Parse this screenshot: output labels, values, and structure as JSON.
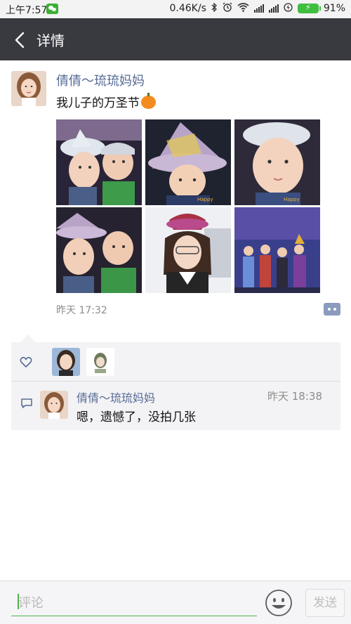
{
  "status_bar": {
    "time": "上午7:57",
    "speed": "0.46K/s",
    "battery": "91%"
  },
  "nav": {
    "title": "详情"
  },
  "post": {
    "author": "倩倩～琉琉妈妈",
    "text": "我儿子的万圣节",
    "time": "昨天 17:32",
    "photo_count": 6
  },
  "comments": [
    {
      "author": "倩倩～琉琉妈妈",
      "time": "昨天 18:38",
      "text": "嗯，遗憾了，没拍几张"
    }
  ],
  "input": {
    "placeholder": "评论",
    "send_label": "发送"
  },
  "colors": {
    "nav_bg": "#393a3f",
    "link": "#576b95",
    "accent_green": "#4cb34c",
    "comment_bg": "#f3f3f5"
  }
}
